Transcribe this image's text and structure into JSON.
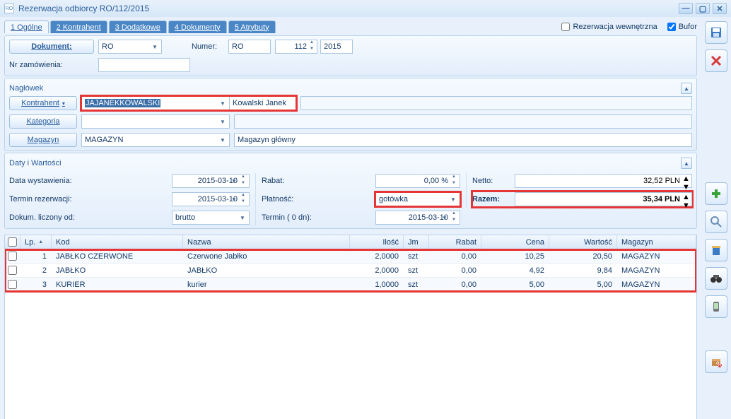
{
  "window": {
    "title": "Rezerwacja odbiorcy RO/112/2015"
  },
  "tabs": [
    "1 Ogólne",
    "2 Kontrahent",
    "3 Dodatkowe",
    "4 Dokumenty",
    "5 Atrybuty"
  ],
  "flags": {
    "rez_wewn_label": "Rezerwacja wewnętrzna",
    "bufor_label": "Bufor",
    "bufor_checked": true,
    "rez_checked": false
  },
  "doc": {
    "dokument_btn": "Dokument:",
    "dokument_val": "RO",
    "numer_lbl": "Numer:",
    "numer_prefix": "RO",
    "numer_no": "112",
    "numer_year": "2015",
    "nrzam_lbl": "Nr zamówienia:",
    "nrzam_val": ""
  },
  "header": {
    "title": "Nagłówek",
    "kontrahent_btn": "Kontrahent",
    "kontrahent_code": "JAJANEKKOWALSKI",
    "kontrahent_name": "Kowalski Janek",
    "kategoria_btn": "Kategoria",
    "kategoria_val": "",
    "magazyn_btn": "Magazyn",
    "magazyn_val": "MAGAZYN",
    "magazyn_name": "Magazyn główny"
  },
  "dates": {
    "title": "Daty i Wartości",
    "data_wyst_lbl": "Data wystawienia:",
    "data_wyst_val": "2015-03-10",
    "termin_rez_lbl": "Termin rezerwacji:",
    "termin_rez_val": "2015-03-10",
    "dokum_lbl": "Dokum. liczony od:",
    "dokum_val": "brutto",
    "rabat_lbl": "Rabat:",
    "rabat_val": "0,00 %",
    "platnosc_lbl": "Płatność:",
    "platnosc_val": "gotówka",
    "termin_lbl": "Termin   (   0 dn):",
    "termin_val": "2015-03-10",
    "netto_lbl": "Netto:",
    "netto_val": "32,52 PLN",
    "razem_lbl": "Razem:",
    "razem_val": "35,34 PLN"
  },
  "grid": {
    "cols": {
      "lp": "Lp.",
      "kod": "Kod",
      "nazwa": "Nazwa",
      "ilosc": "Ilość",
      "jm": "Jm",
      "rabat": "Rabat",
      "cena": "Cena",
      "wartosc": "Wartość",
      "magazyn": "Magazyn"
    },
    "rows": [
      {
        "lp": "1",
        "kod": "JABŁKO CZERWONE",
        "nazwa": "Czerwone Jabłko",
        "il": "2,0000",
        "jm": "szt",
        "rabat": "0,00",
        "cena": "10,25",
        "wart": "20,50",
        "mag": "MAGAZYN"
      },
      {
        "lp": "2",
        "kod": "JABŁKO",
        "nazwa": "JABŁKO",
        "il": "2,0000",
        "jm": "szt",
        "rabat": "0,00",
        "cena": "4,92",
        "wart": "9,84",
        "mag": "MAGAZYN"
      },
      {
        "lp": "3",
        "kod": "KURIER",
        "nazwa": "kurier",
        "il": "1,0000",
        "jm": "szt",
        "rabat": "0,00",
        "cena": "5,00",
        "wart": "5,00",
        "mag": "MAGAZYN"
      }
    ]
  },
  "side_icons": [
    "save",
    "cancel",
    "",
    "",
    "",
    "add",
    "search",
    "bin",
    "binoculars",
    "phone",
    "",
    "box"
  ]
}
